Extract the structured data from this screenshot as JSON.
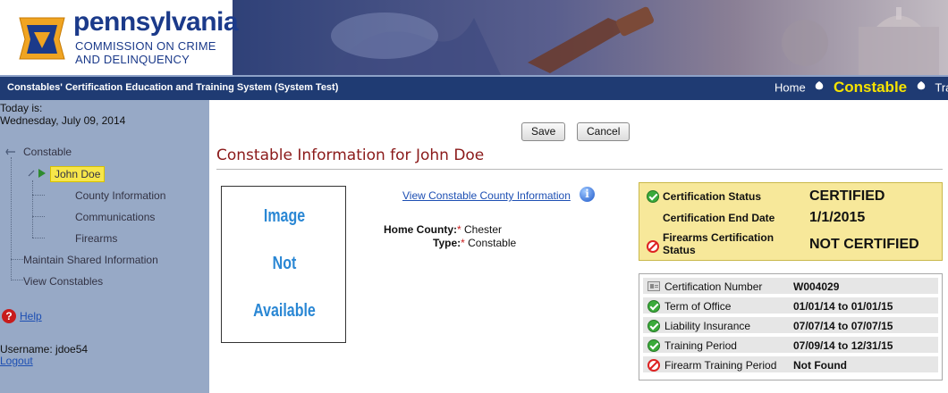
{
  "header": {
    "brand_title": "pennsylvania",
    "brand_line1": "COMMISSION ON CRIME",
    "brand_line2": "AND DELINQUENCY"
  },
  "navstrip": {
    "system_title": "Constables' Certification Education and Training System (System Test)",
    "nav_home": "Home",
    "nav_constable": "Constable",
    "nav_training": "Traini"
  },
  "sidebar": {
    "today_label": "Today is:",
    "today_date": "Wednesday, July 09, 2014",
    "tree": {
      "root": "Constable",
      "selected": "John Doe",
      "children": [
        "County Information",
        "Communications",
        "Firearms"
      ],
      "maintain": "Maintain Shared Information",
      "view": "View Constables"
    },
    "help": "Help",
    "username": "Username: jdoe54",
    "logout": "Logout"
  },
  "main": {
    "save_label": "Save",
    "cancel_label": "Cancel",
    "title": "Constable Information for John Doe",
    "photo_lines": [
      "Image",
      "Not",
      "Available"
    ],
    "county_link": "View Constable County Information",
    "home_county_label": "Home County:",
    "home_county_value": "Chester",
    "type_label": "Type:",
    "type_value": "Constable",
    "required_mark": "*"
  },
  "status": {
    "cert_status_label": "Certification Status",
    "cert_status_value": "CERTIFIED",
    "cert_end_label": "Certification End Date",
    "cert_end_value": "1/1/2015",
    "firearms_label_1": "Firearms Certification",
    "firearms_label_2": "Status",
    "firearms_value": "NOT CERTIFIED"
  },
  "details": [
    {
      "icon": "id-card-icon",
      "label": "Certification Number",
      "value": "W004029"
    },
    {
      "icon": "check-icon",
      "label": "Term of Office",
      "value": "01/01/14 to 01/01/15"
    },
    {
      "icon": "check-icon",
      "label": "Liability Insurance",
      "value": "07/07/14 to 07/07/15"
    },
    {
      "icon": "check-icon",
      "label": "Training Period",
      "value": "07/09/14 to 12/31/15"
    },
    {
      "icon": "prohibited-icon",
      "label": "Firearm Training Period",
      "value": "Not Found"
    }
  ],
  "colors": {
    "nav_bg": "#1f3b73",
    "sidebar_bg": "#97a9c6",
    "title_red": "#8b1a1a",
    "status_yellow": "#f7e89a",
    "link_blue": "#1d4fb3",
    "constable_yellow": "#f6e300"
  }
}
